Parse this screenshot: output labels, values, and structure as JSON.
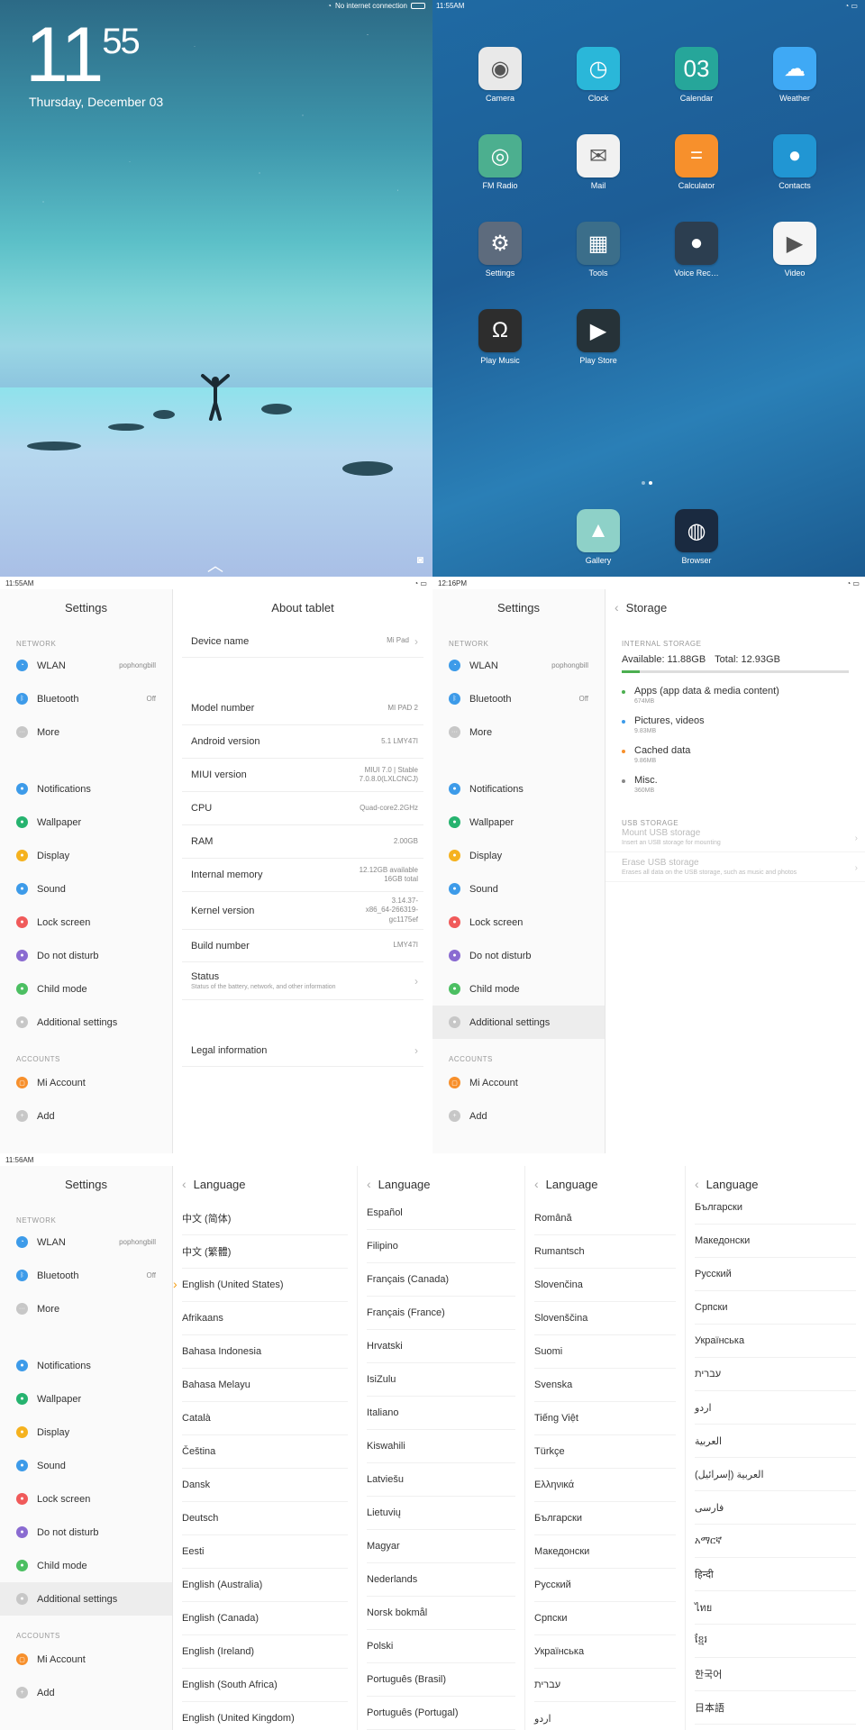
{
  "lock_screen": {
    "time_hour": "11",
    "time_min": "55",
    "date": "Thursday, December 03",
    "status_text": "No internet connection"
  },
  "home_screen": {
    "status_time": "11:55AM",
    "apps": [
      {
        "label": "Camera",
        "icon": "camera-icon",
        "color": "#e9e9e9"
      },
      {
        "label": "Clock",
        "icon": "clock-icon",
        "color": "#2ab7d9"
      },
      {
        "label": "Calendar",
        "icon": "calendar-icon",
        "color": "#26a69a",
        "text": "03"
      },
      {
        "label": "Weather",
        "icon": "weather-icon",
        "color": "#3fa9f5"
      },
      {
        "label": "FM Radio",
        "icon": "radio-icon",
        "color": "#4caf8f"
      },
      {
        "label": "Mail",
        "icon": "mail-icon",
        "color": "#f1f1f1"
      },
      {
        "label": "Calculator",
        "icon": "calculator-icon",
        "color": "#f7902c"
      },
      {
        "label": "Contacts",
        "icon": "contacts-icon",
        "color": "#2196d3"
      },
      {
        "label": "Settings",
        "icon": "gear-icon",
        "color": "#5d6b7d"
      },
      {
        "label": "Tools",
        "icon": "tools-icon",
        "color": "#3b6e8a"
      },
      {
        "label": "Voice Rec…",
        "icon": "microphone-icon",
        "color": "#2c3e50"
      },
      {
        "label": "Video",
        "icon": "play-icon",
        "color": "#f5f5f5"
      },
      {
        "label": "Play Music",
        "icon": "headphones-icon",
        "color": "#2d2d2d"
      },
      {
        "label": "Play Store",
        "icon": "store-icon",
        "color": "#263238"
      }
    ],
    "dock": [
      {
        "label": "Gallery",
        "icon": "gallery-icon",
        "color": "#8ed1c8"
      },
      {
        "label": "Browser",
        "icon": "globe-icon",
        "color": "#1a2a40"
      }
    ]
  },
  "settings": {
    "title": "Settings",
    "network_header": "NETWORK",
    "accounts_header": "ACCOUNTS",
    "wlan": {
      "label": "WLAN",
      "value": "pophongbill"
    },
    "bluetooth": {
      "label": "Bluetooth",
      "value": "Off"
    },
    "more": "More",
    "items": [
      "Notifications",
      "Wallpaper",
      "Display",
      "Sound",
      "Lock screen",
      "Do not disturb",
      "Child mode",
      "Additional settings"
    ],
    "mi_account": "Mi Account",
    "add": "Add",
    "colors": {
      "wlan": "#3d9be9",
      "bluetooth": "#3d9be9",
      "more": "#c7c7c7",
      "notifications": "#3d9be9",
      "wallpaper": "#26b36f",
      "display": "#f5b21f",
      "sound": "#3d9be9",
      "lock": "#f05a5a",
      "dnd": "#8a6bd1",
      "child": "#4cbf62",
      "additional": "#c7c7c7",
      "mi": "#f7902c",
      "add": "#c7c7c7"
    }
  },
  "status": {
    "s2_time": "11:55AM",
    "s3_time": "12:16PM",
    "s4_time": "11:56AM"
  },
  "about_tablet": {
    "title": "About tablet",
    "device_name": {
      "label": "Device name",
      "value": "Mi Pad"
    },
    "model_number": {
      "label": "Model number",
      "value": "MI PAD 2"
    },
    "android_version": {
      "label": "Android version",
      "value": "5.1 LMY47I"
    },
    "miui_version": {
      "label": "MIUI version",
      "value1": "MIUI 7.0 | Stable",
      "value2": "7.0.8.0(LXLCNCJ)"
    },
    "cpu": {
      "label": "CPU",
      "value": "Quad-core2.2GHz"
    },
    "ram": {
      "label": "RAM",
      "value": "2.00GB"
    },
    "internal_memory": {
      "label": "Internal memory",
      "value1": "12.12GB available",
      "value2": "16GB total"
    },
    "kernel_version": {
      "label": "Kernel version",
      "value1": "3.14.37-",
      "value2": "x86_64-266319-",
      "value3": "gc1175ef"
    },
    "build_number": {
      "label": "Build number",
      "value": "LMY47I"
    },
    "status": {
      "label": "Status",
      "sub": "Status of the battery, network, and other information"
    },
    "legal": {
      "label": "Legal information"
    }
  },
  "storage": {
    "title": "Storage",
    "internal_header": "INTERNAL STORAGE",
    "available": "Available: 11.88GB",
    "total": "Total: 12.93GB",
    "used_fraction": 0.08,
    "items": [
      {
        "label": "Apps (app data & media content)",
        "size": "674MB",
        "color": "#4caf50"
      },
      {
        "label": "Pictures, videos",
        "size": "9.83MB",
        "color": "#3d9be9"
      },
      {
        "label": "Cached data",
        "size": "9.86MB",
        "color": "#f7902c"
      },
      {
        "label": "Misc.",
        "size": "360MB",
        "color": "#888888"
      }
    ],
    "usb_header": "USB STORAGE",
    "mount": {
      "label": "Mount USB storage",
      "sub": "Insert an USB storage for mounting"
    },
    "erase": {
      "label": "Erase USB storage",
      "sub": "Erases all data on the USB storage, such as music and photos"
    }
  },
  "language": {
    "title": "Language",
    "col1": [
      "中文 (简体)",
      "中文 (繁體)",
      "English (United States)",
      "Afrikaans",
      "Bahasa Indonesia",
      "Bahasa Melayu",
      "Català",
      "Čeština",
      "Dansk",
      "Deutsch",
      "Eesti",
      "English (Australia)",
      "English (Canada)",
      "English (Ireland)",
      "English (South Africa)",
      "English (United Kingdom)"
    ],
    "col2": [
      "Español",
      "Filipino",
      "Français (Canada)",
      "Français (France)",
      "Hrvatski",
      "IsiZulu",
      "Italiano",
      "Kiswahili",
      "Latviešu",
      "Lietuvių",
      "Magyar",
      "Nederlands",
      "Norsk bokmål",
      "Polski",
      "Português (Brasil)",
      "Português (Portugal)"
    ],
    "col3": [
      "Română",
      "Rumantsch",
      "Slovenčina",
      "Slovenščina",
      "Suomi",
      "Svenska",
      "Tiếng Việt",
      "Türkçe",
      "Ελληνικά",
      "Български",
      "Македонски",
      "Русский",
      "Српски",
      "Українська",
      "עברית",
      "اردو"
    ],
    "col4": [
      "Български",
      "Македонски",
      "Русский",
      "Српски",
      "Українська",
      "עברית",
      "اردو",
      "العربية",
      "العربية (إسرائيل)",
      "فارسی",
      "አማርኛ",
      "हिन्दी",
      "ไทย",
      "ខ្មែរ",
      "한국어",
      "日本語"
    ]
  }
}
